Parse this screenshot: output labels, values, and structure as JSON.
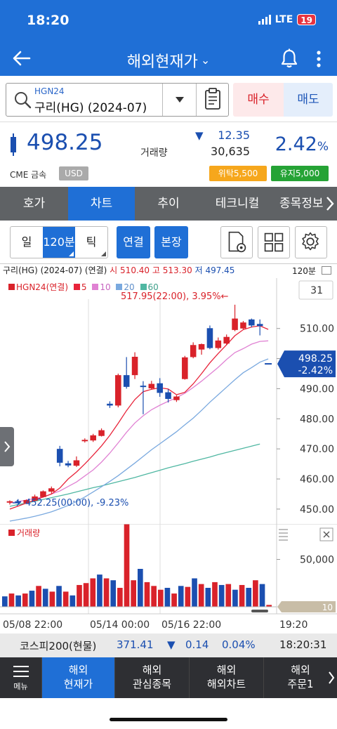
{
  "status": {
    "time": "18:20",
    "network": "LTE",
    "battery": "19"
  },
  "header": {
    "title": "해외현재가",
    "title_caret": "⌄"
  },
  "search": {
    "code": "HGN24",
    "name": "구리(HG) (2024-07)"
  },
  "trade": {
    "buy": "매수",
    "sell": "매도"
  },
  "quote": {
    "price": "498.25",
    "change_arrow": "▼",
    "change": "12.35",
    "volume_label": "거래량",
    "volume": "30,635",
    "pct": "2.42",
    "pct_unit": "%",
    "exchange": "CME 금속",
    "currency": "USD",
    "badge_risk": "위탁5,500",
    "badge_hold": "유지5,000"
  },
  "tabs": [
    "호가",
    "차트",
    "추이",
    "테크니컬",
    "종목정보"
  ],
  "toolbar": {
    "day": "일",
    "interval": "120분",
    "tick": "틱",
    "link": "연결",
    "combine": "본장"
  },
  "chart_info": {
    "name": "구리(HG) (2024-07) (연결)",
    "high_label": "시",
    "open": "510.40",
    "hi_label": "고",
    "high": "513.30",
    "lo_label": "저",
    "low": "497.45",
    "interval": "120분"
  },
  "legend": {
    "main": "HGN24(연결)",
    "ma": [
      "5",
      "10",
      "20",
      "60"
    ]
  },
  "colors": {
    "up": "#d9222a",
    "down": "#1b4fb0",
    "ma5": "#e8233a",
    "ma10": "#e082d3",
    "ma20": "#7aa9df",
    "ma60": "#4fb7a2"
  },
  "chart_data": {
    "type": "candlestick",
    "y_ticks": [
      "510.00",
      "500.00",
      "490.00",
      "480.00",
      "470.00",
      "460.00",
      "450.00"
    ],
    "ylim": [
      446,
      523
    ],
    "x_labels": [
      "05/08 22:00",
      "05/14 00:00",
      "05/16 22:00"
    ],
    "x_time_label": "19:20",
    "count_box": "31",
    "current": {
      "price": "498.25",
      "pct": "-2.42%"
    },
    "annot_high": "517.95(22:00), 3.95%←",
    "annot_low": "452.25(00:00), -9.23%",
    "candles": [
      {
        "o": 452.4,
        "h": 452.9,
        "l": 451.5,
        "c": 452.6
      },
      {
        "o": 452.6,
        "h": 453.3,
        "l": 451.8,
        "c": 452.3
      },
      {
        "o": 452.0,
        "h": 453.2,
        "l": 451.9,
        "c": 453.0
      },
      {
        "o": 452.8,
        "h": 454.8,
        "l": 452.5,
        "c": 454.2
      },
      {
        "o": 454.0,
        "h": 456.2,
        "l": 453.8,
        "c": 455.9
      },
      {
        "o": 455.8,
        "h": 457.5,
        "l": 455.2,
        "c": 456.9
      },
      {
        "o": 470.0,
        "h": 471.0,
        "l": 464.2,
        "c": 465.4
      },
      {
        "o": 465.2,
        "h": 466.0,
        "l": 463.9,
        "c": 464.5
      },
      {
        "o": 464.4,
        "h": 467.5,
        "l": 464.0,
        "c": 466.2
      },
      {
        "o": 472.9,
        "h": 473.5,
        "l": 472.1,
        "c": 473.0
      },
      {
        "o": 472.8,
        "h": 475.0,
        "l": 472.3,
        "c": 474.5
      },
      {
        "o": 474.3,
        "h": 476.8,
        "l": 474.1,
        "c": 476.2
      },
      {
        "o": 485.0,
        "h": 485.8,
        "l": 483.6,
        "c": 484.4
      },
      {
        "o": 484.4,
        "h": 495.0,
        "l": 483.8,
        "c": 494.5
      },
      {
        "o": 494.5,
        "h": 500.5,
        "l": 490.0,
        "c": 490.6
      },
      {
        "o": 494.5,
        "h": 502.1,
        "l": 493.2,
        "c": 500.6
      },
      {
        "o": 491.0,
        "h": 492.5,
        "l": 481.5,
        "c": 490.6
      },
      {
        "o": 490.1,
        "h": 492.6,
        "l": 489.7,
        "c": 491.6
      },
      {
        "o": 491.8,
        "h": 493.5,
        "l": 487.3,
        "c": 488.6
      },
      {
        "o": 488.8,
        "h": 489.8,
        "l": 485.4,
        "c": 486.6
      },
      {
        "o": 486.2,
        "h": 487.8,
        "l": 485.6,
        "c": 487.4
      },
      {
        "o": 493.2,
        "h": 500.9,
        "l": 493.0,
        "c": 500.4
      },
      {
        "o": 500.5,
        "h": 505.4,
        "l": 500.1,
        "c": 504.5
      },
      {
        "o": 503.0,
        "h": 505.0,
        "l": 501.3,
        "c": 504.8
      },
      {
        "o": 510.1,
        "h": 511.0,
        "l": 503.1,
        "c": 503.5
      },
      {
        "o": 503.5,
        "h": 507.0,
        "l": 503.0,
        "c": 506.0
      },
      {
        "o": 505.0,
        "h": 508.0,
        "l": 504.5,
        "c": 507.2
      },
      {
        "o": 509.5,
        "h": 517.9,
        "l": 509.1,
        "c": 513.3
      },
      {
        "o": 510.0,
        "h": 512.5,
        "l": 509.7,
        "c": 512.0
      },
      {
        "o": 513.0,
        "h": 513.3,
        "l": 510.4,
        "c": 511.0
      },
      {
        "o": 511.5,
        "h": 513.0,
        "l": 507.7,
        "c": 510.8
      },
      {
        "o": 498.25,
        "h": 498.25,
        "l": 498.25,
        "c": 498.25
      }
    ],
    "ma": {
      "ma5": [
        450.0,
        451.0,
        452.0,
        453.0,
        454.0,
        455.0,
        457.0,
        460.0,
        462.3,
        465.0,
        467.9,
        471.0,
        474.5,
        478.5,
        482.7,
        486.4,
        489.0,
        489.8,
        490.3,
        489.9,
        488.0,
        488.8,
        491.6,
        495.0,
        498.6,
        501.7,
        504.6,
        507.6,
        509.6,
        510.5,
        510.9,
        509.7
      ],
      "ma10": [
        452.0,
        452.5,
        453.0,
        453.5,
        454.0,
        455.0,
        456.0,
        457.5,
        459.0,
        461.0,
        463.0,
        465.6,
        468.6,
        472.0,
        475.5,
        478.6,
        481.0,
        483.0,
        484.5,
        485.8,
        487.0,
        488.5,
        490.4,
        492.5,
        494.8,
        497.1,
        499.7,
        502.0,
        503.3,
        504.8,
        505.7,
        505.9
      ],
      "ma20": [
        446.0,
        446.5,
        447.0,
        447.6,
        448.3,
        449.1,
        450.1,
        451.2,
        452.5,
        454.0,
        455.7,
        457.4,
        459.2,
        461.1,
        463.2,
        465.3,
        467.5,
        469.7,
        471.7,
        473.7,
        475.7,
        478.0,
        480.2,
        482.8,
        485.5,
        488.0,
        490.5,
        493.0,
        495.3,
        497.0,
        498.8,
        499.9
      ],
      "ma60": [
        450.9,
        451.5,
        452.0,
        452.6,
        453.2,
        453.8,
        454.4,
        455.0,
        455.7,
        456.4,
        457.1,
        457.7,
        458.4,
        459.1,
        459.8,
        460.5,
        461.3,
        462.1,
        462.9,
        463.7,
        464.4,
        465.1,
        465.9,
        466.6,
        467.3,
        468.1,
        468.8,
        469.5,
        470.2,
        470.9,
        471.6
      ]
    },
    "volume_label": "거래량",
    "volume_tick": "50,000",
    "volume_max": 80000,
    "volume_count_box": "10",
    "volumes": [
      11000,
      14000,
      12000,
      14000,
      17000,
      22000,
      19000,
      16000,
      22000,
      16000,
      12000,
      23000,
      25000,
      30000,
      34000,
      30000,
      28000,
      20000,
      87000,
      28000,
      40000,
      26000,
      22000,
      18000,
      20000,
      14000,
      22000,
      21000,
      30000,
      24000,
      20000,
      26000,
      23000,
      24000,
      18000,
      23000,
      20000,
      28000,
      24000,
      2000
    ]
  },
  "ticker": {
    "name": "코스피200(현물)",
    "value": "371.41",
    "arrow": "▼",
    "change": "0.14",
    "pct": "0.04%",
    "time": "18:20:31"
  },
  "bottom_nav": {
    "menu": "메뉴",
    "items": [
      {
        "l1": "해외",
        "l2": "현재가"
      },
      {
        "l1": "해외",
        "l2": "관심종목"
      },
      {
        "l1": "해외",
        "l2": "해외차트"
      },
      {
        "l1": "해외",
        "l2": "주문1"
      }
    ]
  }
}
